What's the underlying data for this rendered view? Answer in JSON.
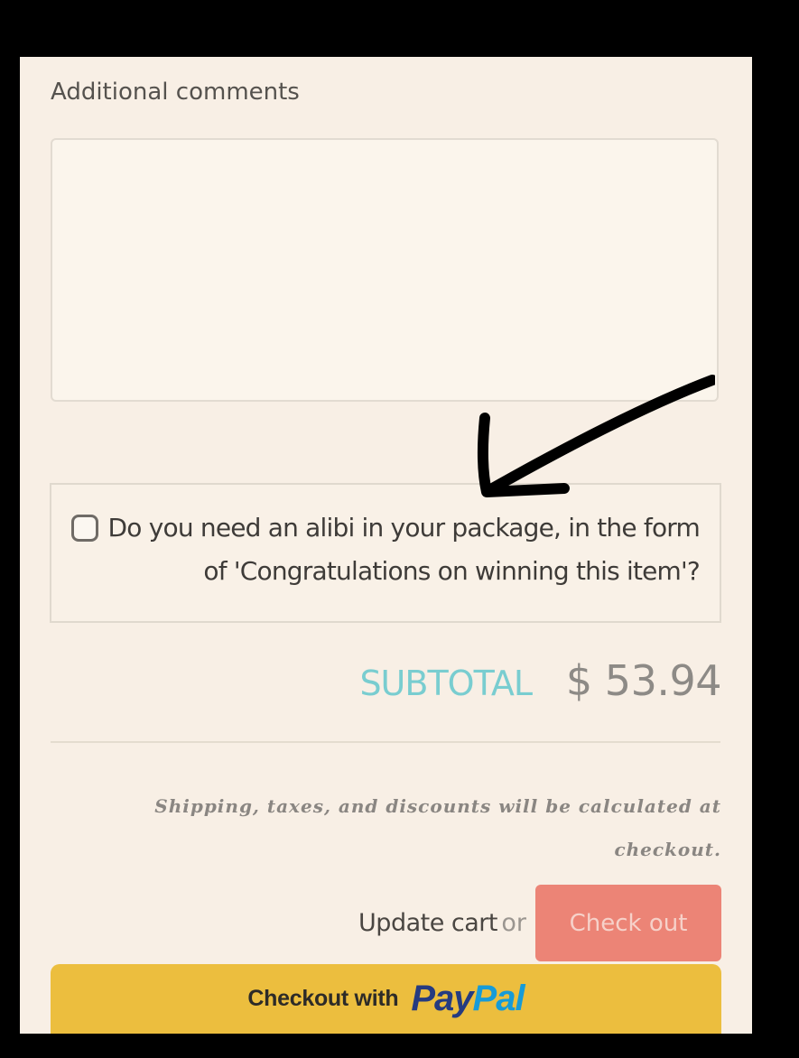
{
  "form": {
    "comments_label": "Additional comments",
    "comments_value": "",
    "alibi_option": {
      "checked": false,
      "label_line1": "Do you need an alibi in your package, in the form",
      "label_line2": "of 'Congratulations on winning this item'?"
    }
  },
  "cart": {
    "subtotal_label": "SUBTOTAL",
    "subtotal_value": "$ 53.94",
    "shipping_note_line1": "Shipping, taxes, and discounts will be calculated at",
    "shipping_note_line2": "checkout."
  },
  "actions": {
    "update_cart_label": "Update cart",
    "or_text": "or",
    "checkout_label": "Check out",
    "paypal_prefix": "Checkout with",
    "paypal_brand_pay": "Pay",
    "paypal_brand_pal": "Pal"
  },
  "colors": {
    "page_background": "#f8efe5",
    "subtotal_label": "#79cdd0",
    "checkout_button": "#ec8476",
    "paypal_button": "#ecbe3e",
    "paypal_dark_blue": "#253b80",
    "paypal_light_blue": "#179bd7",
    "annotation_arrow": "#000000"
  },
  "annotation": {
    "icon": "hand-drawn-arrow-icon"
  }
}
